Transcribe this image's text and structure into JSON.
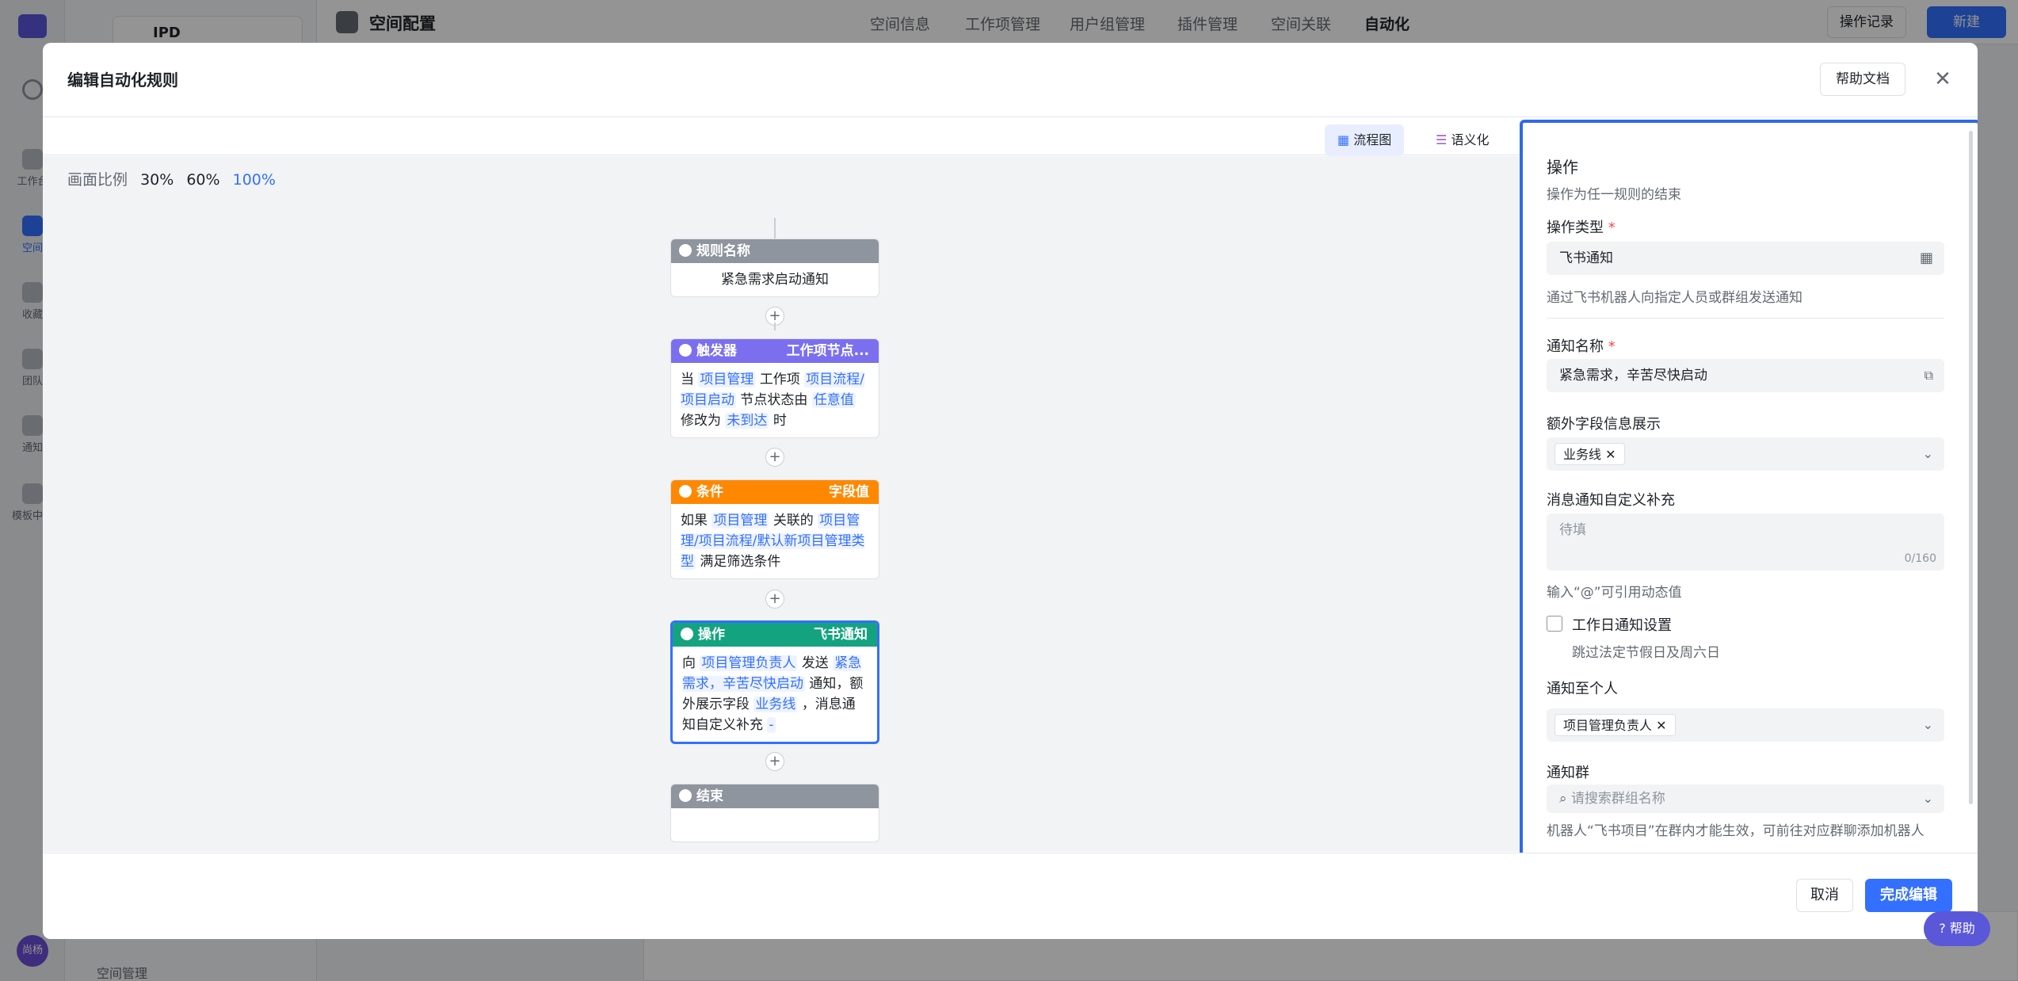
{
  "app": {
    "space_name": "IPD",
    "page_title": "空间配置",
    "top_tabs": [
      "空间信息",
      "工作项管理",
      "用户组管理",
      "插件管理",
      "空间关联",
      "自动化"
    ],
    "active_tab": "自动化",
    "op_log_label": "操作记录",
    "new_label": "新建",
    "rail_items": [
      "工作台",
      "空间",
      "收藏",
      "团队",
      "通知",
      "模板中心"
    ],
    "avatar_text": "尚杨",
    "space_manage_label": "空间管理"
  },
  "modal": {
    "title": "编辑自动化规则",
    "help_doc_label": "帮助文档",
    "view_tabs": [
      "流程图",
      "语义化"
    ],
    "active_view": "流程图",
    "zoom_label": "画面比例",
    "zoom_options": [
      "30%",
      "60%",
      "100%"
    ],
    "active_zoom": "100%",
    "cancel_label": "取消",
    "finish_label": "完成编辑"
  },
  "flow": {
    "rule_node": {
      "header": "规则名称",
      "body": "紧急需求启动通知",
      "color": "#8f959e"
    },
    "trigger_node": {
      "header": "触发器",
      "tag": "工作项节点...",
      "color": "#7b6ff0",
      "parts": [
        "当",
        "项目管理",
        "工作项",
        "项目流程/项目启动",
        "节点状态由",
        "任意值",
        "修改为",
        "未到达",
        "时"
      ]
    },
    "condition_node": {
      "header": "条件",
      "tag": "字段值",
      "color": "#ff8800",
      "parts": [
        "如果",
        "项目管理",
        "关联的",
        "项目管理/项目流程/默认新项目管理类型",
        "满足筛选条件"
      ]
    },
    "action_node": {
      "header": "操作",
      "tag": "飞书通知",
      "color": "#14a37f",
      "parts": [
        "向",
        "项目管理负责人",
        "发送",
        "紧急需求，辛苦尽快启动",
        "通知，额外展示字段",
        "业务线",
        "，消息通知自定义补充",
        "-"
      ]
    },
    "end_node": {
      "header": "结束",
      "color": "#8f959e"
    },
    "plus": "+"
  },
  "panel": {
    "title": "操作",
    "subtitle": "操作为任一规则的结束",
    "op_type_label": "操作类型",
    "op_type_value": "飞书通知",
    "op_type_hint": "通过飞书机器人向指定人员或群组发送通知",
    "notify_name_label": "通知名称",
    "notify_name_value": "紧急需求，辛苦尽快启动",
    "extra_fields_label": "额外字段信息展示",
    "extra_fields_chip": "业务线",
    "custom_msg_label": "消息通知自定义补充",
    "custom_msg_placeholder": "待填",
    "custom_msg_counter": "0/160",
    "custom_msg_hint": "输入“@”可引用动态值",
    "workday_label": "工作日通知设置",
    "workday_hint": "跳过法定节假日及周六日",
    "notify_person_label": "通知至个人",
    "notify_person_chip": "项目管理负责人",
    "notify_group_label": "通知群",
    "notify_group_placeholder": "请搜索群组名称",
    "notify_group_hint": "机器人“飞书项目”在群内才能生效，可前往对应群聊添加机器人"
  },
  "help_fab_label": "帮助",
  "colors": {
    "accent": "#3370ff",
    "panel_border": "#2f6ae8"
  }
}
